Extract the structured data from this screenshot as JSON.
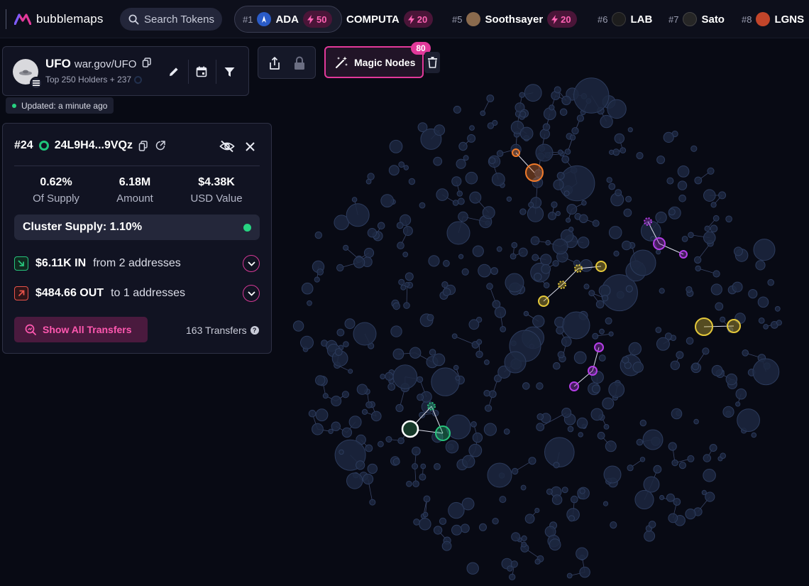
{
  "brand": {
    "name": "bubblemaps"
  },
  "search": {
    "label": "Search Tokens"
  },
  "trending": [
    {
      "rank": "#1",
      "name": "ADA",
      "boost": "50",
      "icon_color": "#3b6fd8"
    },
    {
      "rank": "",
      "name": "COMPUTA",
      "boost": "20",
      "icon_color": ""
    },
    {
      "rank": "#5",
      "name": "Soothsayer",
      "boost": "20",
      "icon_color": "#8a6a4d"
    },
    {
      "rank": "#6",
      "name": "LAB",
      "boost": "",
      "icon_color": "#1d1d1d"
    },
    {
      "rank": "#7",
      "name": "Sato",
      "boost": "",
      "icon_color": "#262626"
    },
    {
      "rank": "#8",
      "name": "LGNS",
      "boost": "",
      "icon_color": "#c2452a"
    }
  ],
  "token": {
    "symbol": "UFO",
    "name": "war.gov/UFO",
    "subtitle": "Top 250 Holders + 237",
    "updated": "Updated: a minute ago"
  },
  "toolbar": {
    "magic_label": "Magic Nodes",
    "magic_count": "80"
  },
  "wallet": {
    "rank": "#24",
    "address": "24L9H4...9VQz",
    "stats": [
      {
        "value": "0.62%",
        "label": "Of Supply"
      },
      {
        "value": "6.18M",
        "label": "Amount"
      },
      {
        "value": "$4.38K",
        "label": "USD Value"
      }
    ],
    "cluster_supply": "Cluster Supply: 1.10%",
    "inflow": {
      "amount": "$6.11K IN",
      "detail": "from 2 addresses"
    },
    "outflow": {
      "amount": "$484.66 OUT",
      "detail": "to 1 addresses"
    },
    "show_all_label": "Show All Transfers",
    "transfers_label": "163 Transfers"
  },
  "colors": {
    "accent": "#e2399a",
    "bubble": "#1c2740",
    "bubble_edge": "#2c3b5c",
    "cluster_orange": "#f07a2a",
    "cluster_yellow": "#e4c83a",
    "cluster_purple": "#b43ee6",
    "cluster_green": "#27c47c"
  }
}
